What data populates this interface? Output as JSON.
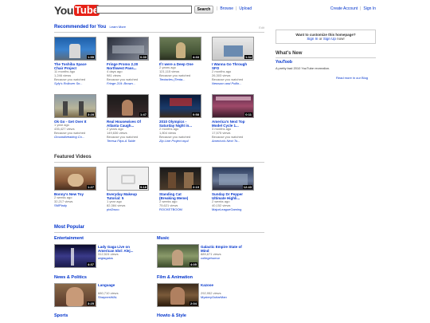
{
  "header": {
    "logo_you": "You",
    "logo_tube": "Tube",
    "search_button": "Search",
    "browse": "Browse",
    "upload": "Upload",
    "sep": "|",
    "create_account": "Create Account",
    "sign_in": "Sign In"
  },
  "recommended": {
    "title": "Recommended for You",
    "learn_more": "Learn More",
    "edit": "Edit",
    "videos": [
      {
        "title1": "The Toshiba Space",
        "title2": "Chair Project",
        "dur": "1:55",
        "meta1": "11 months ago",
        "meta2": "1,246 views",
        "meta3": "Because you watched",
        "src": "Syfy's Rollover Sn..."
      },
      {
        "title1": "Fringe Promo 2.20",
        "title2": "Northwest Pass...",
        "dur": "0:30",
        "meta1": "4 days ago",
        "meta2": "981 views",
        "meta3": "Because you watched",
        "src": "Fringe 219: Brown..."
      },
      {
        "title1": "If I were a Deep One",
        "title2": "",
        "dur": "4:33",
        "meta1": "2 years ago",
        "meta2": "121,115 views",
        "meta3": "Because you watched",
        "src": "Tentacles (Tenta..."
      },
      {
        "title1": "I Wanna Go Through",
        "title2": "SFO",
        "dur": "1:34",
        "meta1": "2 months ago",
        "meta2": "26,303 views",
        "meta3": "Because you watched",
        "src": "Newsom and Pollin..."
      },
      {
        "title1": "Ok Go - Get Over It",
        "title2": "",
        "dur": "3:28",
        "meta1": "1 year ago",
        "meta2": "435,427 views",
        "meta3": "Because you watched",
        "src": "Groundbreaking Co..."
      },
      {
        "title1": "Real Housewives Of",
        "title2": "Atlanta Caugh...",
        "dur": "1:47",
        "meta1": "2 years ago",
        "meta2": "149,636 views",
        "meta3": "Because you watched",
        "src": "Teresa Flips A Table"
      },
      {
        "title1": "2010 Olympics -",
        "title2": "Saturday Night in...",
        "dur": "0:58",
        "meta1": "2 months ago",
        "meta2": "1,804 views",
        "meta3": "Because you watched",
        "src": "Zip Line Project.mp4"
      },
      {
        "title1": "America's Next Top",
        "title2": "Model Cycle 1...",
        "dur": "0:11",
        "meta1": "3 months ago",
        "meta2": "17,575 views",
        "meta3": "Because you watched",
        "src": "America's Next To..."
      }
    ]
  },
  "featured": {
    "title": "Featured Videos",
    "videos": [
      {
        "title1": "Bonny's New Toy",
        "title2": "",
        "dur": "1:27",
        "meta1": "2 weeks ago",
        "meta2": "32,217 views",
        "user": "SMPlady"
      },
      {
        "title1": "Everyday Makeup",
        "title2": "Tutorial: 5",
        "dur": "5:18",
        "meta1": "1 year ago",
        "meta2": "82,384 views",
        "user": "pixi2woo"
      },
      {
        "title1": "Standing Cat",
        "title2": "(Breaking Meme)",
        "dur": "2:19",
        "meta1": "2 weeks ago",
        "meta2": "75,621 views",
        "user": "ROCKETBOOM"
      },
      {
        "title1": "Sunday Dr Pepper",
        "title2": "Ultimate Highli...",
        "dur": "12:43",
        "meta1": "2 weeks ago",
        "meta2": "40,152 views",
        "user": "MajorLeagueGaming"
      }
    ]
  },
  "most_popular": {
    "title": "Most Popular",
    "categories": [
      {
        "name": "Entertainment",
        "title1": "Lady Gaga Live on",
        "title2": "American Idol: Alej...",
        "views": "312,524 views",
        "user": "wigtagalos",
        "dur": "4:37"
      },
      {
        "name": "Music",
        "title1": "Galactic Empire State of",
        "title2": "Mind",
        "views": "889,671 views",
        "user": "collegehumor",
        "dur": "4:05"
      },
      {
        "name": "News & Politics",
        "title1": "Language",
        "title2": "",
        "views": "680,710 views",
        "user": "ShaynesWAL",
        "dur": "3:25"
      },
      {
        "name": "Film & Animation",
        "title1": "Kazooe",
        "title2": "",
        "views": "292,952 views",
        "user": "MysteryGuitarMan",
        "dur": "2:04"
      },
      {
        "name": "Sports",
        "title1": "",
        "title2": "",
        "views": "",
        "user": "",
        "dur": ""
      },
      {
        "name": "Howto & Style",
        "title1": "",
        "title2": "",
        "views": "",
        "user": "",
        "dur": ""
      }
    ]
  },
  "sidebar": {
    "custom_q": "Want to customize this homepage?",
    "sign_in": "Sign In",
    "or": "or",
    "sign_up": "Sign Up",
    "now": "now!",
    "whats_new": "What's New",
    "item_title": "YouToob",
    "item_desc": "A pretty bad 2010 YouTube recreation.",
    "read_more": "Read more in our Blog"
  }
}
